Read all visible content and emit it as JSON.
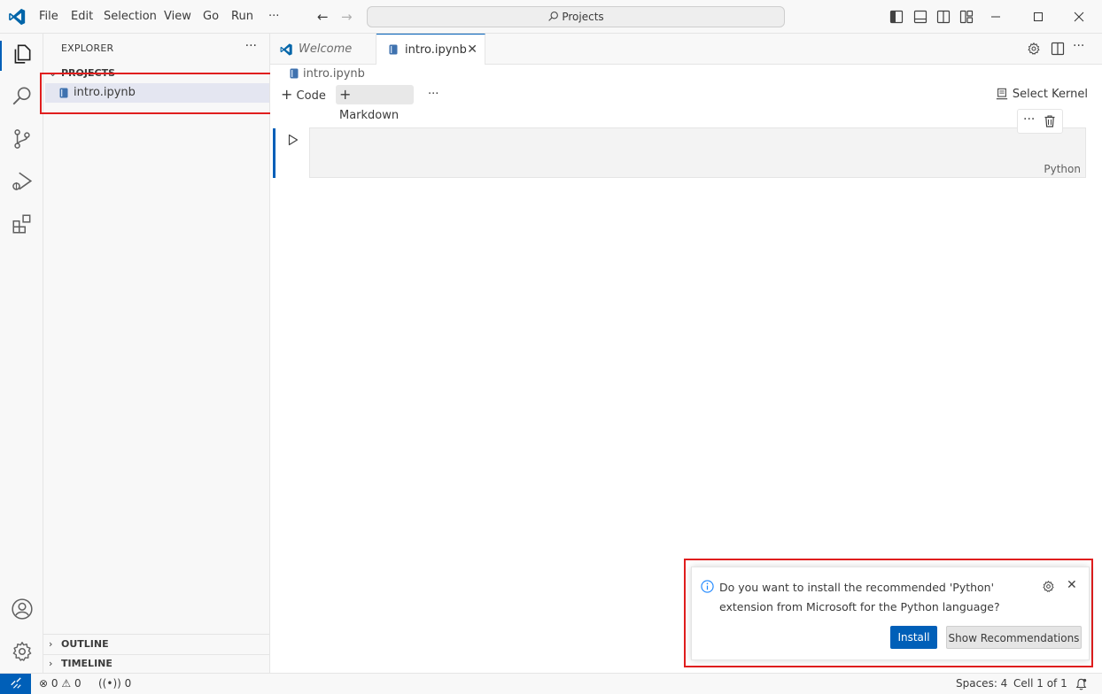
{
  "titlebar": {
    "menu": [
      "File",
      "Edit",
      "Selection",
      "View",
      "Go",
      "Run",
      "···"
    ],
    "command_center": "Projects"
  },
  "sidebar": {
    "title": "EXPLORER",
    "more": "···",
    "folder": "PROJECTS",
    "file": "intro.ipynb",
    "sections": [
      "OUTLINE",
      "TIMELINE"
    ]
  },
  "tabs": [
    {
      "label": "Welcome",
      "active": false
    },
    {
      "label": "intro.ipynb",
      "active": true,
      "close": "✕"
    }
  ],
  "editor": {
    "breadcrumb": "intro.ipynb",
    "toolbar": {
      "code": "Code",
      "markdown": "Markdown",
      "more": "···"
    },
    "kernel": "Select Kernel",
    "cell": {
      "language": "Python",
      "more": "···"
    }
  },
  "notification": {
    "message": "Do you want to install the recommended 'Python' extension from Microsoft for the Python language?",
    "install_label": "Install",
    "show_recommendations_label": "Show Recommendations",
    "close": "✕"
  },
  "statusbar": {
    "errors": "0",
    "warnings": "0",
    "ports": "0",
    "spaces": "Spaces: 4",
    "cell_position": "Cell 1 of 1"
  },
  "colors": {
    "accent": "#005fb8",
    "highlight_outline": "#e01e1e"
  }
}
